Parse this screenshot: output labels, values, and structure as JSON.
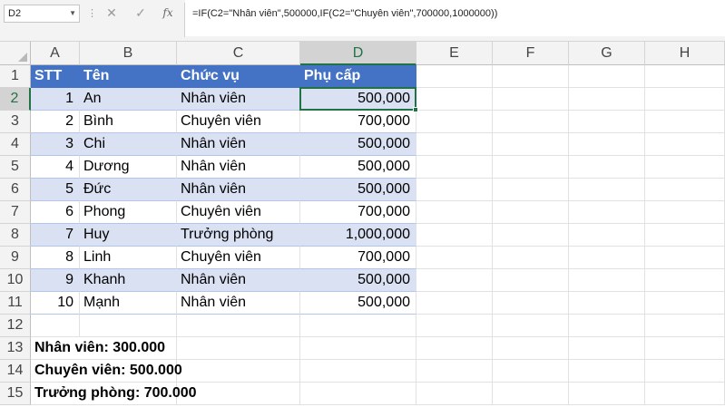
{
  "formula_bar": {
    "name_box": "D2",
    "cancel_glyph": "✕",
    "enter_glyph": "✓",
    "fx_glyph": "fx",
    "formula": "=IF(C2=\"Nhân viên\",500000,IF(C2=\"Chuyên viên\",700000,1000000))"
  },
  "columns": [
    "A",
    "B",
    "C",
    "D",
    "E",
    "F",
    "G",
    "H"
  ],
  "rows": [
    "1",
    "2",
    "3",
    "4",
    "5",
    "6",
    "7",
    "8",
    "9",
    "10",
    "11",
    "12",
    "13",
    "14",
    "15"
  ],
  "selected": {
    "column": "D",
    "row": "2"
  },
  "table": {
    "headers": [
      "STT",
      "Tên",
      "Chức vụ",
      "Phụ cấp"
    ],
    "rows": [
      [
        "1",
        "An",
        "Nhân viên",
        "500,000"
      ],
      [
        "2",
        "Bình",
        "Chuyên viên",
        "700,000"
      ],
      [
        "3",
        "Chi",
        "Nhân viên",
        "500,000"
      ],
      [
        "4",
        "Dương",
        "Nhân viên",
        "500,000"
      ],
      [
        "5",
        "Đức",
        "Nhân viên",
        "500,000"
      ],
      [
        "6",
        "Phong",
        "Chuyên viên",
        "700,000"
      ],
      [
        "7",
        "Huy",
        "Trưởng phòng",
        "1,000,000"
      ],
      [
        "8",
        "Linh",
        "Chuyên viên",
        "700,000"
      ],
      [
        "9",
        "Khanh",
        "Nhân viên",
        "500,000"
      ],
      [
        "10",
        "Mạnh",
        "Nhân viên",
        "500,000"
      ]
    ]
  },
  "notes": [
    "Nhân viên: 300.000",
    "Chuyên viên: 500.000",
    "Trưởng phòng: 700.000"
  ],
  "colors": {
    "header_fill": "#4472c4",
    "band_fill": "#d9e1f2",
    "selection": "#217346"
  }
}
